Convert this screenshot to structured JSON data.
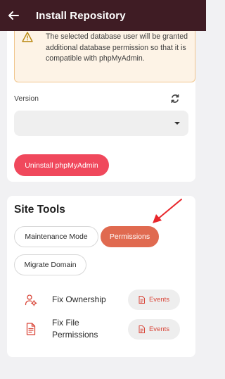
{
  "header": {
    "title": "Install Repository",
    "back_icon": "arrow-left-icon"
  },
  "warning": {
    "icon": "warning-triangle-icon",
    "text": "The selected database user will be granted additional database permission so that it is compatible with phpMyAdmin."
  },
  "version": {
    "label": "Version",
    "value": "",
    "refresh_icon": "refresh-icon"
  },
  "uninstall_button": "Uninstall phpMyAdmin",
  "site_tools": {
    "title": "Site Tools",
    "chips": [
      {
        "label": "Maintenance Mode",
        "active": false
      },
      {
        "label": "Permissions",
        "active": true
      },
      {
        "label": "Migrate Domain",
        "active": false
      }
    ],
    "tools": [
      {
        "label": "Fix Ownership",
        "icon": "user-gear-icon",
        "events_label": "Events"
      },
      {
        "label": "Fix File Permissions",
        "icon": "file-icon",
        "events_label": "Events"
      }
    ]
  },
  "colors": {
    "appbar": "#3f1c24",
    "accent_red": "#f0485c",
    "active_chip": "#e06a50",
    "warning_bg": "#fdf3e6",
    "warning_border": "#f1c68e"
  }
}
